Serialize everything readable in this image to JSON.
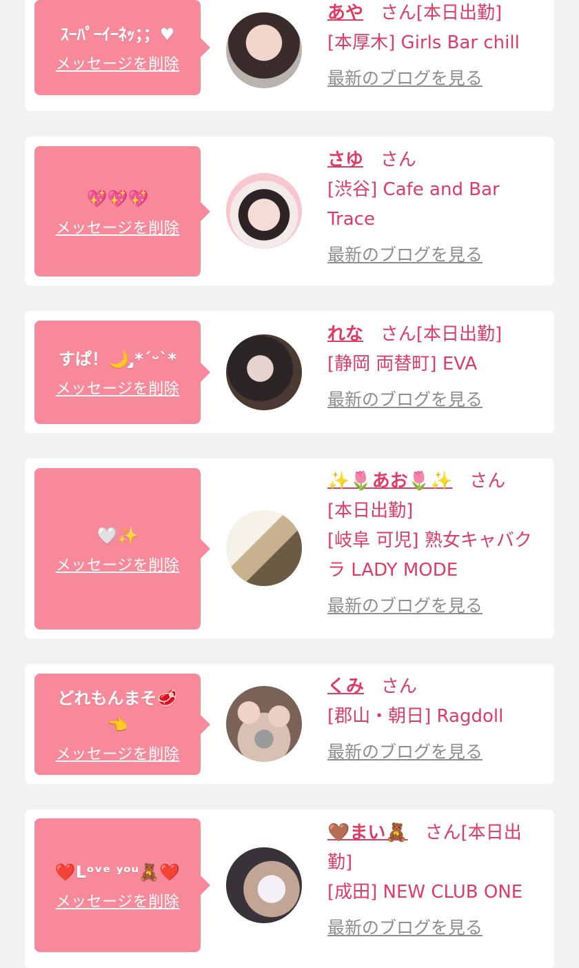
{
  "delete_label": "メッセージを削除",
  "blog_label": "最新のブログを見る",
  "san_label": "さん",
  "colors": {
    "bubble": "#f8899a",
    "accent": "#e23a63",
    "link_gray": "#8d8d8d",
    "bg": "#f2f2f2"
  },
  "cards": [
    {
      "message": "ｽｰﾊﾟｰｲｰﾈｯ；；♥",
      "name": "あや",
      "status": "[本日出勤]",
      "shop": "[本厚木] Girls Bar chill",
      "avatar_icon": "avatar-photo"
    },
    {
      "message": "💖💖💖",
      "name": "さゆ",
      "status": "",
      "shop": "[渋谷] Cafe and Bar Trace",
      "avatar_icon": "avatar-photo"
    },
    {
      "message": "すぱ！🌙 ̨̡‪*ˊᵕˋ*",
      "name": "れな",
      "status": "[本日出勤]",
      "shop": "[静岡 両替町] EVA",
      "avatar_icon": "avatar-photo"
    },
    {
      "message": "🤍✨",
      "name": "✨🌷あお🌷✨",
      "status": "[本日出勤]",
      "shop": "[岐阜 可児] 熟女キャバクラ LADY MODE",
      "avatar_icon": "avatar-photo"
    },
    {
      "message": "どれもんまそ🥩\n👈",
      "name": "くみ",
      "status": "",
      "shop": "[郡山・朝日] Ragdoll",
      "avatar_icon": "avatar-photo"
    },
    {
      "message": "❤️Lᵒᵛᵉ ʸᵒᵘ🧸❤️",
      "name": "🤎まい🧸",
      "status": "[本日出勤]",
      "shop": "[成田] NEW CLUB ONE",
      "avatar_icon": "avatar-photo"
    }
  ]
}
